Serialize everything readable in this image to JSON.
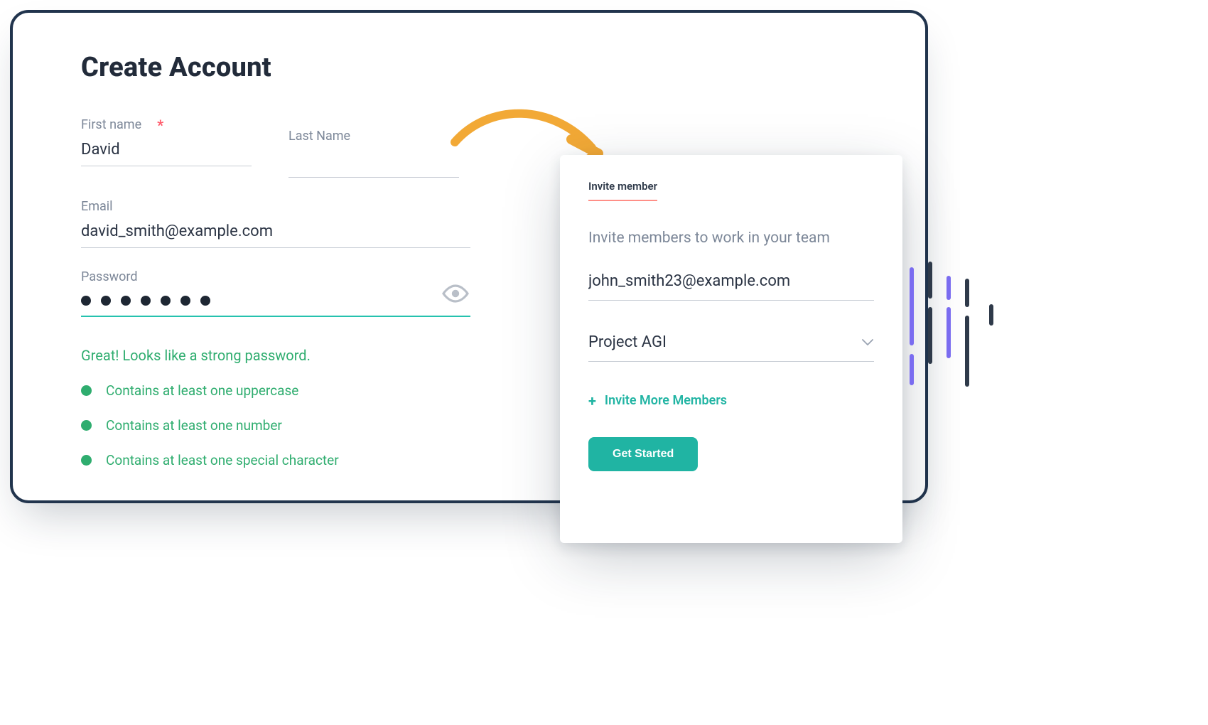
{
  "create": {
    "title": "Create Account",
    "first_name": {
      "label": "First name",
      "value": "David",
      "required_mark": "*"
    },
    "last_name": {
      "label": "Last Name",
      "value": ""
    },
    "email": {
      "label": "Email",
      "value": "david_smith@example.com"
    },
    "password": {
      "label": "Password",
      "strength_message": "Great! Looks like a strong password.",
      "checks": [
        "Contains at least one uppercase",
        "Contains at least one number",
        "Contains at least one special character"
      ]
    }
  },
  "invite": {
    "tab_label": "Invite member",
    "heading": "Invite members to work in your team",
    "email_value": "john_smith23@example.com",
    "project_value": "Project AGI",
    "invite_more_label": "Invite More Members",
    "get_started_label": "Get Started"
  },
  "colors": {
    "teal": "#20b4a3",
    "green": "#2fad6f",
    "orange": "#f2a936",
    "coral": "#ff8f87",
    "purple": "#7a6cf0",
    "dark": "#2f3a4a"
  }
}
